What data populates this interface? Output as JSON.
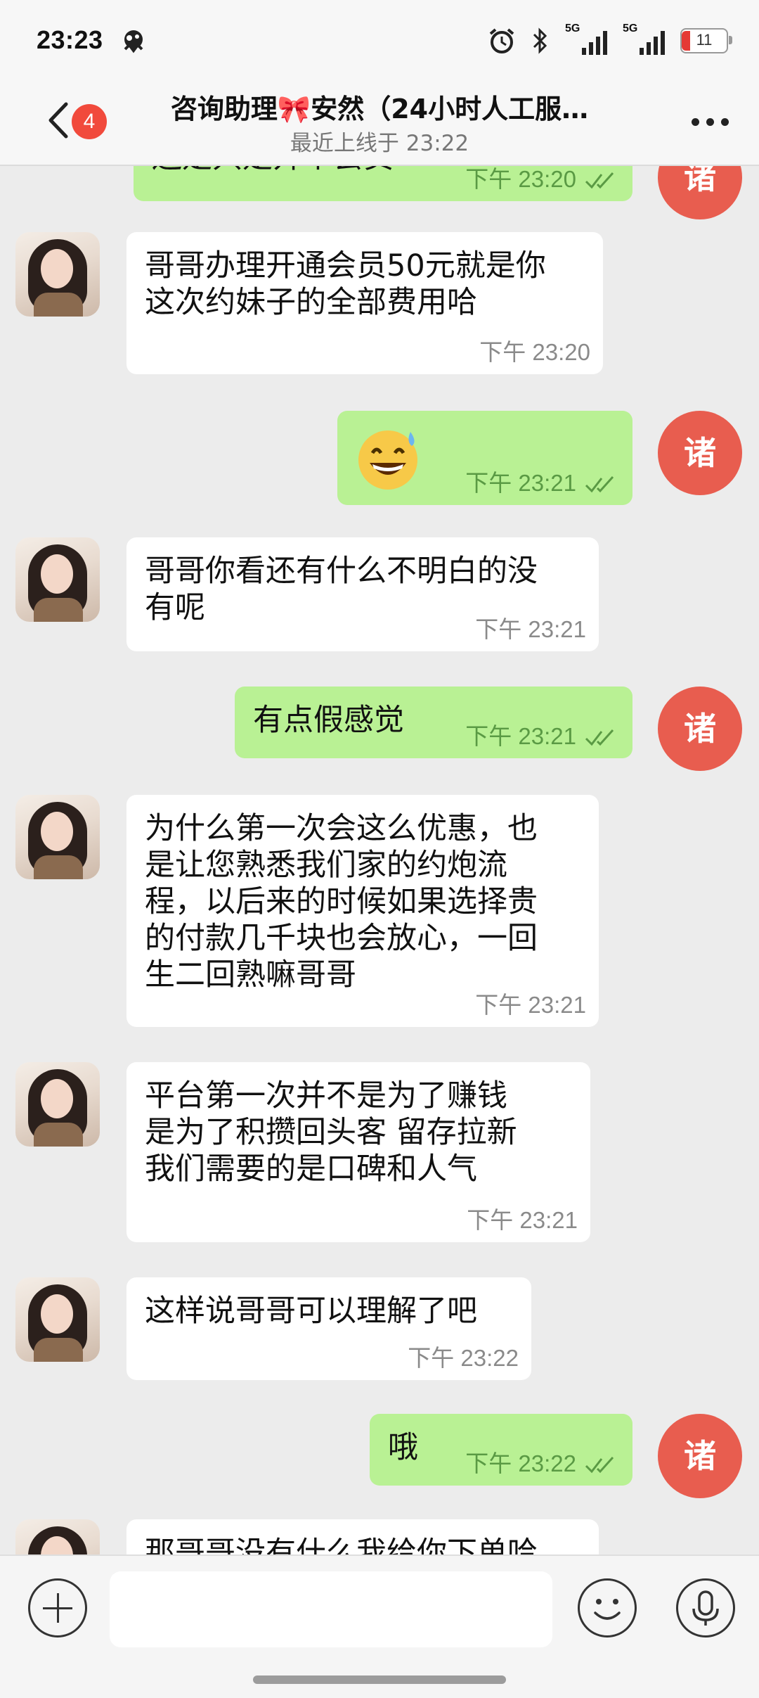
{
  "status_bar": {
    "time": "23:23",
    "signal_1": "5G",
    "signal_2": "5G",
    "battery": "11"
  },
  "header": {
    "unread_count": "4",
    "title": "咨询助理🎀安然（24小时人工服…",
    "subtitle": "最近上线于 23:22"
  },
  "contact_initial": "诸",
  "messages": [
    {
      "dir": "out",
      "text": "还是只是开个会员",
      "time": "下午  23:20"
    },
    {
      "dir": "in",
      "text": "哥哥办理开通会员50元就是你\n这次约妹子的全部费用哈",
      "time": "下午  23:20"
    },
    {
      "dir": "out",
      "emoji": "grinning-face-with-sweat",
      "time": "下午  23:21"
    },
    {
      "dir": "in",
      "text": "哥哥你看还有什么不明白的没\n有呢",
      "time": "下午  23:21"
    },
    {
      "dir": "out",
      "text": "有点假感觉",
      "time": "下午  23:21"
    },
    {
      "dir": "in",
      "text": "为什么第一次会这么优惠，也\n是让您熟悉我们家的约炮流\n程，以后来的时候如果选择贵\n的付款几千块也会放心，一回\n生二回熟嘛哥哥",
      "time": "下午  23:21"
    },
    {
      "dir": "in",
      "text": "平台第一次并不是为了赚钱\n是为了积攒回头客 留存拉新\n我们需要的是口碑和人气",
      "time": "下午  23:21"
    },
    {
      "dir": "in",
      "text": "这样说哥哥可以理解了吧",
      "time": "下午  23:22"
    },
    {
      "dir": "out",
      "text": "哦",
      "time": "下午  23:22"
    },
    {
      "dir": "in",
      "text": "那哥哥没有什么我给你下单哈",
      "time": ""
    }
  ],
  "input": {
    "placeholder": ""
  },
  "colors": {
    "incoming_bubble": "#ffffff",
    "outgoing_bubble": "#b9f194",
    "avatar_right": "#e85d4f",
    "badge": "#f14a3c"
  }
}
